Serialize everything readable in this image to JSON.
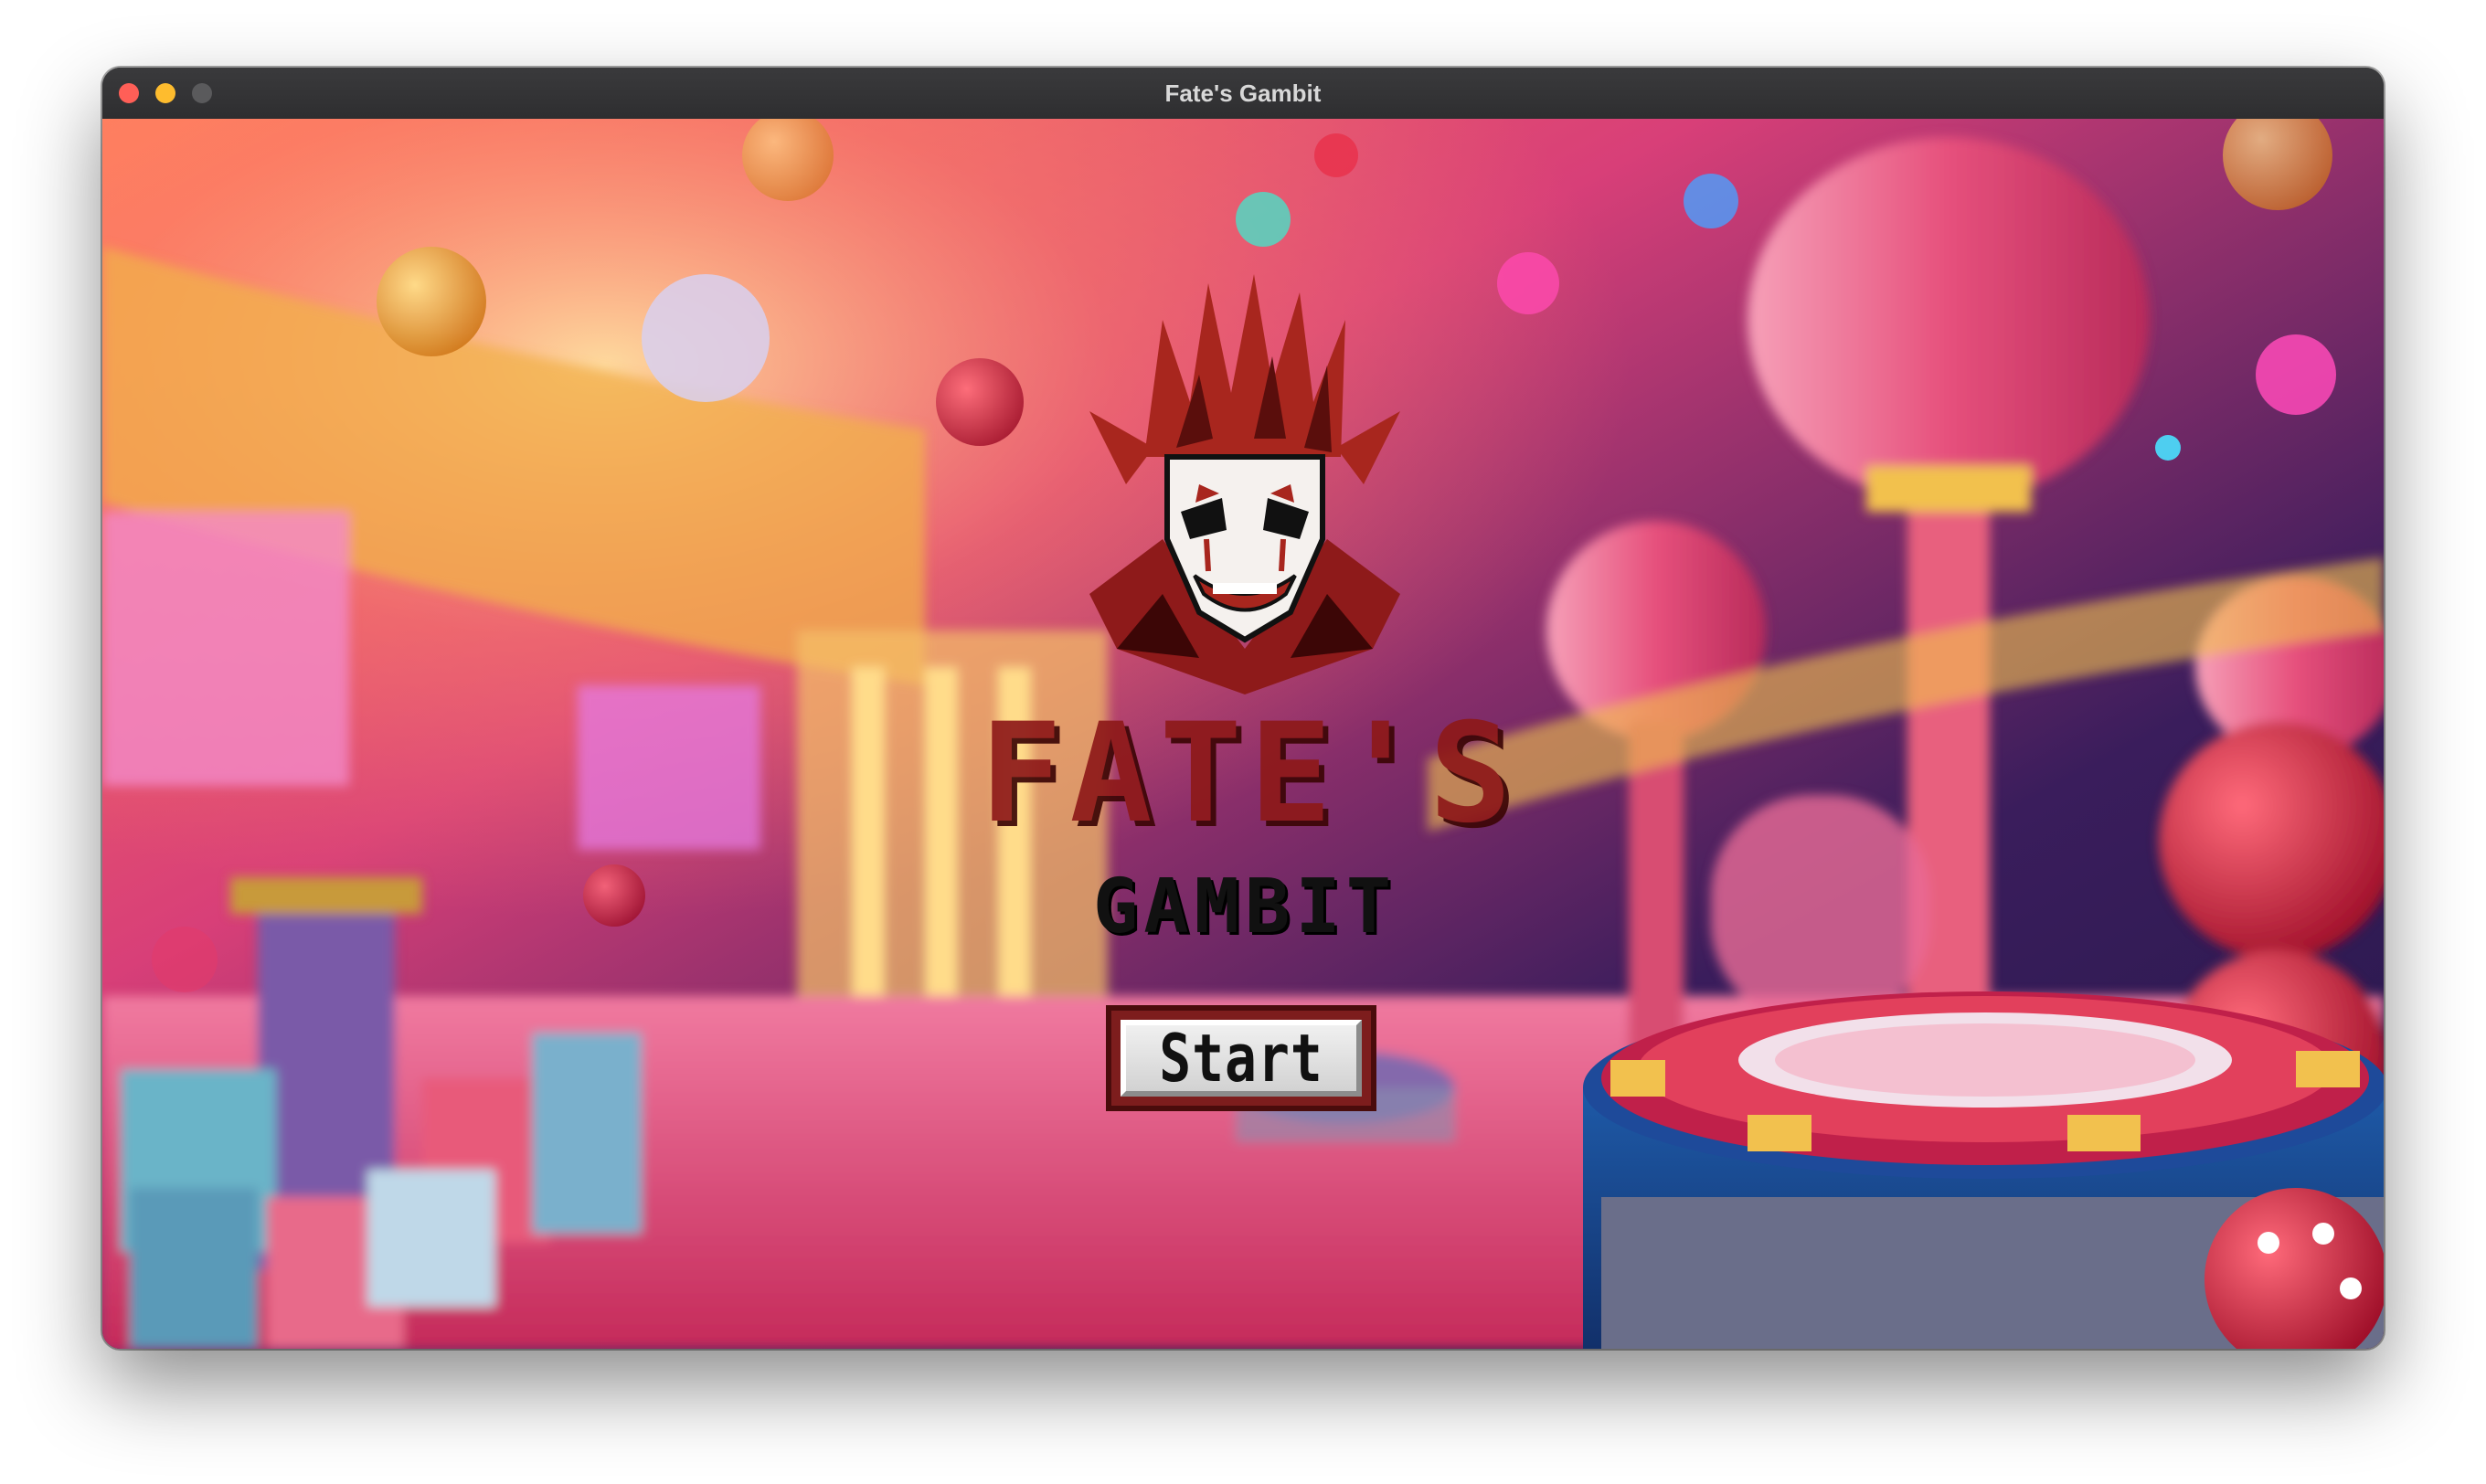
{
  "window": {
    "title": "Fate's Gambit"
  },
  "game": {
    "logo": {
      "line1": "Fate's",
      "line2": "Gambit",
      "mascot_icon": "jester-mask-icon"
    },
    "start_button_label": "Start"
  },
  "colors": {
    "title_red": "#8e1a1a",
    "button_frame": "#7d1d1d",
    "button_face": "#e6e6e6",
    "background_pink": "#e0487a",
    "background_purple": "#3a1d5c",
    "gold": "#f2c14e"
  },
  "icons": [
    "close-icon",
    "minimize-icon",
    "maximize-icon",
    "jester-mask-icon"
  ]
}
